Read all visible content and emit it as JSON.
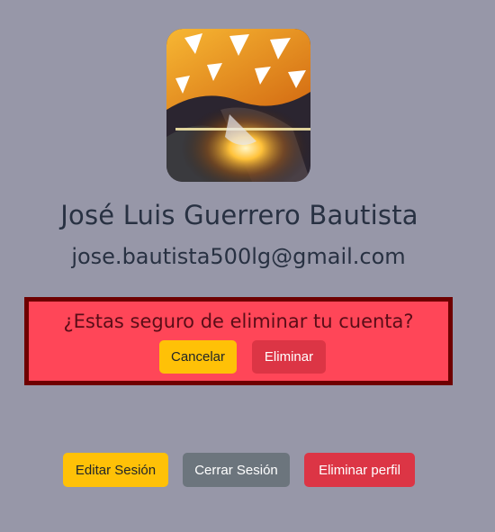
{
  "profile": {
    "avatar_icon": "profile-photo-anime",
    "name": "José Luis Guerrero Bautista",
    "email": "jose.bautista500lg@gmail.com"
  },
  "confirm_dialog": {
    "question": "¿Estas seguro de eliminar tu cuenta?",
    "cancel_label": "Cancelar",
    "delete_label": "Eliminar",
    "background_color": "#ff4658",
    "border_color": "#6e0000"
  },
  "actions": {
    "edit_label": "Editar Sesión",
    "logout_label": "Cerrar Sesión",
    "delete_profile_label": "Eliminar perfil"
  },
  "colors": {
    "page_background": "#9797a8",
    "warning": "#ffc107",
    "secondary": "#6c757d",
    "danger": "#dc3545"
  }
}
